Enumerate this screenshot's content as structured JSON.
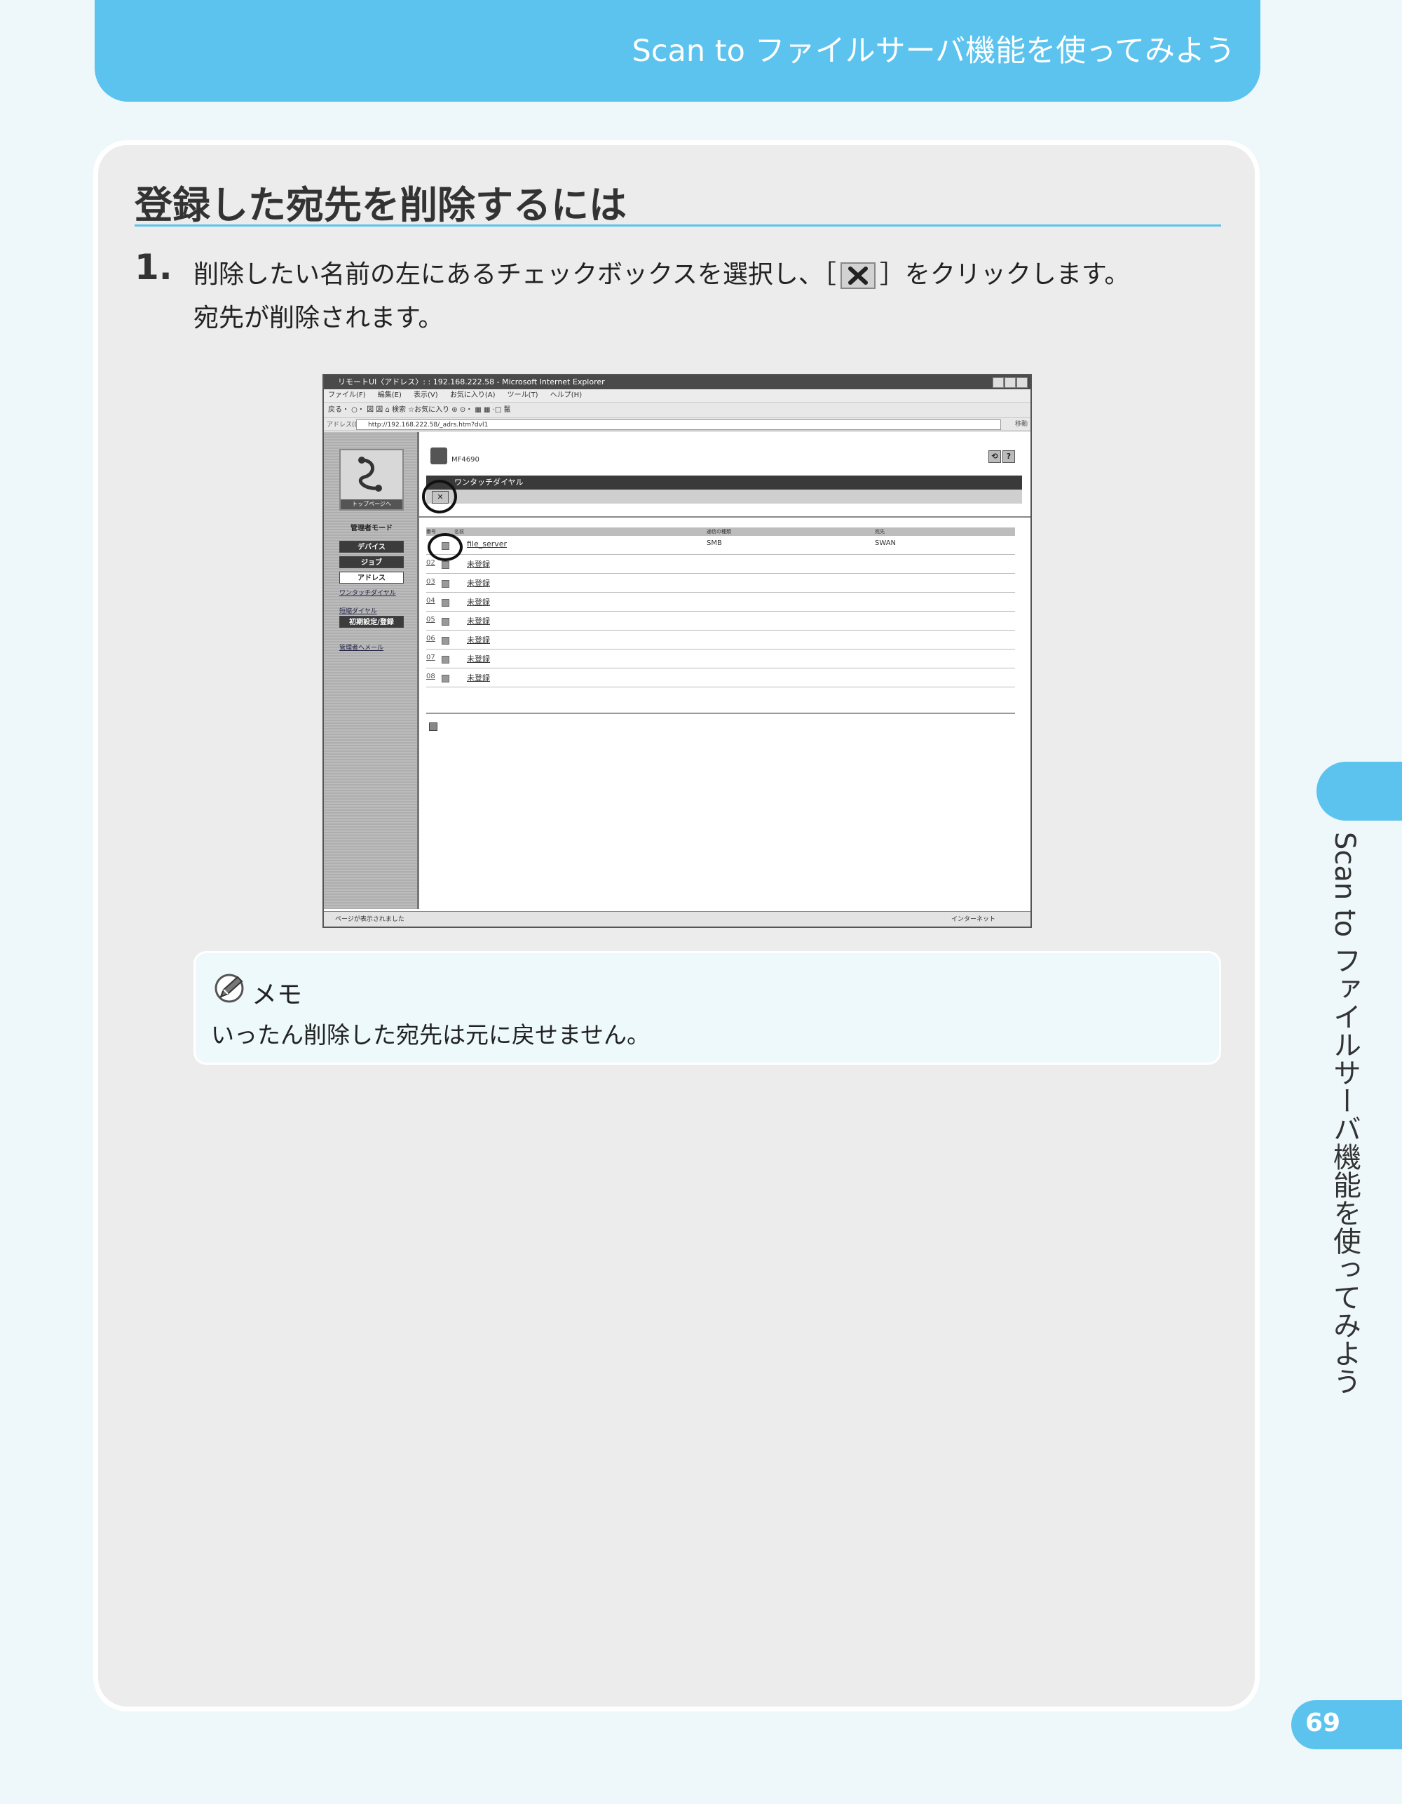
{
  "header": {
    "title": "Scan to ファイルサーバ機能を使ってみよう"
  },
  "section": {
    "title": "登録した宛先を削除するには"
  },
  "step": {
    "number": "1.",
    "text_before": "削除したい名前の左にあるチェックボックスを選択し、［",
    "text_after": "］をクリックします。",
    "sub": "宛先が削除されます。"
  },
  "screenshot": {
    "window_title": "リモートUI〈アドレス〉: : 192.168.222.58 - Microsoft Internet Explorer",
    "menu": "ファイル(F) 編集(E) 表示(V) お気に入り(A) ツール(T) ヘルプ(H)",
    "toolbar": "戻る・ ○・ 図 図 ⌂  検索  ☆お気に入り ⊛  ⊙・ ▦ ▦ ·□ 鬣",
    "address_label": "アドレス(D)",
    "address_url": "http://192.168.222.58/_adrs.htm?dvl1",
    "go_label": "移動",
    "logo_caption": "トップページへ",
    "mode_label": "管理者モード",
    "nav": [
      "デバイス",
      "ジョブ",
      "アドレス"
    ],
    "sublinks": [
      "ワンタッチダイヤル",
      "短縮ダイヤル"
    ],
    "init_btn": "初期設定/登録",
    "admin_mail": "管理者へメール",
    "device_name": "MF4690",
    "heading": "ワンタッチダイヤル",
    "delete_btn": "✕",
    "table_headers": [
      "番号",
      "名前",
      "通信の種類",
      "宛先"
    ],
    "rows": [
      {
        "no": "",
        "name": "file_server",
        "type": "SMB",
        "dest": "SWAN"
      },
      {
        "no": "02",
        "name": "未登録",
        "type": "",
        "dest": ""
      },
      {
        "no": "03",
        "name": "未登録",
        "type": "",
        "dest": ""
      },
      {
        "no": "04",
        "name": "未登録",
        "type": "",
        "dest": ""
      },
      {
        "no": "05",
        "name": "未登録",
        "type": "",
        "dest": ""
      },
      {
        "no": "06",
        "name": "未登録",
        "type": "",
        "dest": ""
      },
      {
        "no": "07",
        "name": "未登録",
        "type": "",
        "dest": ""
      },
      {
        "no": "08",
        "name": "未登録",
        "type": "",
        "dest": ""
      }
    ],
    "status": "ページが表示されました",
    "zone": "インターネット"
  },
  "memo": {
    "title": "メモ",
    "text": "いったん削除した宛先は元に戻せません。"
  },
  "side_tab": {
    "text": "Scan to ファイルサーバ機能を使ってみよう"
  },
  "page_number": "69",
  "colors": {
    "accent": "#5bc3ee",
    "panel": "#ececec",
    "background": "#eef8fb"
  }
}
